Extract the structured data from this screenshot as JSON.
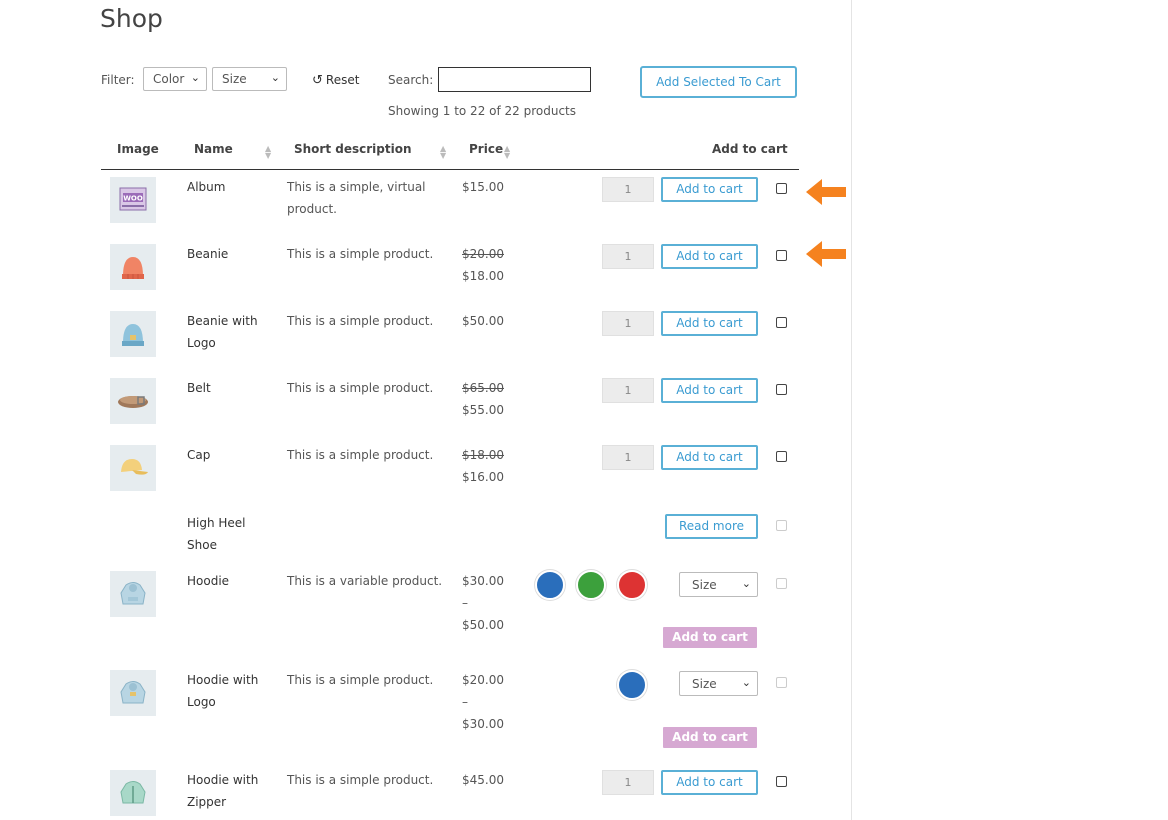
{
  "page": {
    "title": "Shop"
  },
  "filter": {
    "label": "Filter:",
    "color_select": "Color",
    "size_select": "Size",
    "reset_label": "Reset",
    "search_label": "Search:",
    "search_value": ""
  },
  "actions": {
    "add_selected_label": "Add Selected To Cart"
  },
  "status": {
    "showing": "Showing 1 to 22 of 22 products"
  },
  "table": {
    "headers": {
      "image": "Image",
      "name": "Name",
      "description": "Short description",
      "price": "Price",
      "add_to_cart": "Add to cart"
    },
    "rows": [
      {
        "name": "Album",
        "description": "This is a simple, virtual product.",
        "price": "$15.00",
        "qty": "1",
        "button": "Add to cart",
        "icon": "album-image"
      },
      {
        "name": "Beanie",
        "description": "This is a simple product.",
        "old_price": "$20.00",
        "price": "$18.00",
        "qty": "1",
        "button": "Add to cart",
        "icon": "beanie-image"
      },
      {
        "name": "Beanie with Logo",
        "description": "This is a simple product.",
        "price": "$50.00",
        "qty": "1",
        "button": "Add to cart",
        "icon": "beanie-logo-image"
      },
      {
        "name": "Belt",
        "description": "This is a simple product.",
        "old_price": "$65.00",
        "price": "$55.00",
        "qty": "1",
        "button": "Add to cart",
        "icon": "belt-image"
      },
      {
        "name": "Cap",
        "description": "This is a simple product.",
        "old_price": "$18.00",
        "price": "$16.00",
        "qty": "1",
        "button": "Add to cart",
        "icon": "cap-image"
      },
      {
        "name": "High Heel Shoe",
        "button": "Read more"
      },
      {
        "name": "Hoodie",
        "description": "This is a variable product.",
        "price_from": "$30.00",
        "price_sep": "–",
        "price_to": "$50.00",
        "size_select": "Size",
        "button": "Add to cart",
        "swatches": [
          "#2a6ebb",
          "#3ca03c",
          "#dd3333"
        ],
        "icon": "hoodie-image"
      },
      {
        "name": "Hoodie with Logo",
        "description": "This is a simple product.",
        "price_from": "$20.00",
        "price_sep": "–",
        "price_to": "$30.00",
        "size_select": "Size",
        "button": "Add to cart",
        "swatches": [
          "#2a6ebb"
        ],
        "icon": "hoodie-logo-image"
      },
      {
        "name": "Hoodie with Zipper",
        "description": "This is a simple product.",
        "price": "$45.00",
        "qty": "1",
        "button": "Add to cart",
        "icon": "hoodie-zipper-image"
      }
    ]
  },
  "colors": {
    "accent": "#3a9bd1",
    "button_border": "#5ab0d6",
    "disabled_button": "#d6a8d2",
    "arrow": "#f5821f"
  }
}
